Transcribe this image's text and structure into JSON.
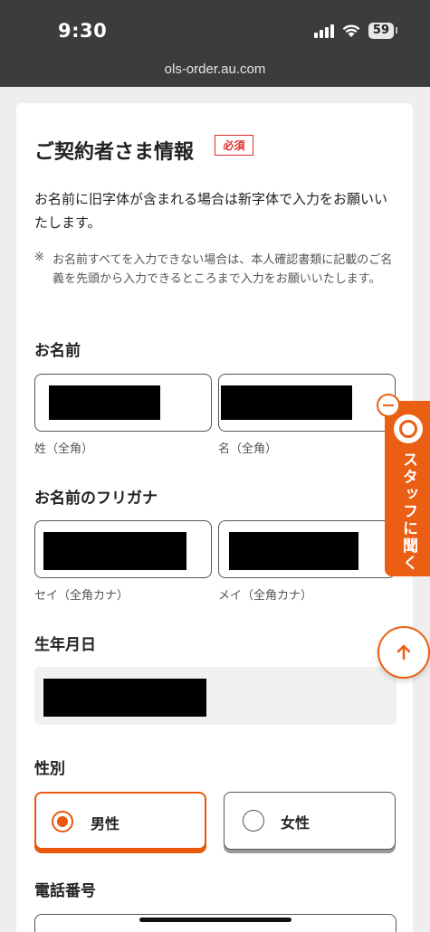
{
  "status_bar": {
    "time": "9:30",
    "battery": "59",
    "url": "ols-order.au.com",
    "icons": [
      "signal-icon",
      "wifi-icon",
      "battery-icon"
    ]
  },
  "form": {
    "title": "ご契約者さま情報",
    "required_badge": "必須",
    "intro": "お名前に旧字体が含まれる場合は新字体で入力をお願いいたします。",
    "note_mark": "※",
    "note": "お名前すべてを入力できない場合は、本人確認書類に記載のご名義を先頭から入力できるところまで入力をお願いいたします。",
    "name": {
      "label": "お名前",
      "last_sub": "姓（全角）",
      "first_sub": "名（全角）"
    },
    "furigana": {
      "label": "お名前のフリガナ",
      "last_sub": "セイ（全角カナ）",
      "first_sub": "メイ（全角カナ）"
    },
    "birthdate": {
      "label": "生年月日"
    },
    "gender": {
      "label": "性別",
      "options": [
        "男性",
        "女性"
      ],
      "selected": "男性"
    },
    "phone": {
      "label": "電話番号"
    }
  },
  "floating": {
    "staff_tab_label": "スタッフに聞く",
    "icons": [
      "minus-icon",
      "operator-icon",
      "arrow-up-icon"
    ]
  },
  "colors": {
    "accent": "#ea5f13",
    "required": "#e03030",
    "status_bar": "#3a3c3e"
  }
}
